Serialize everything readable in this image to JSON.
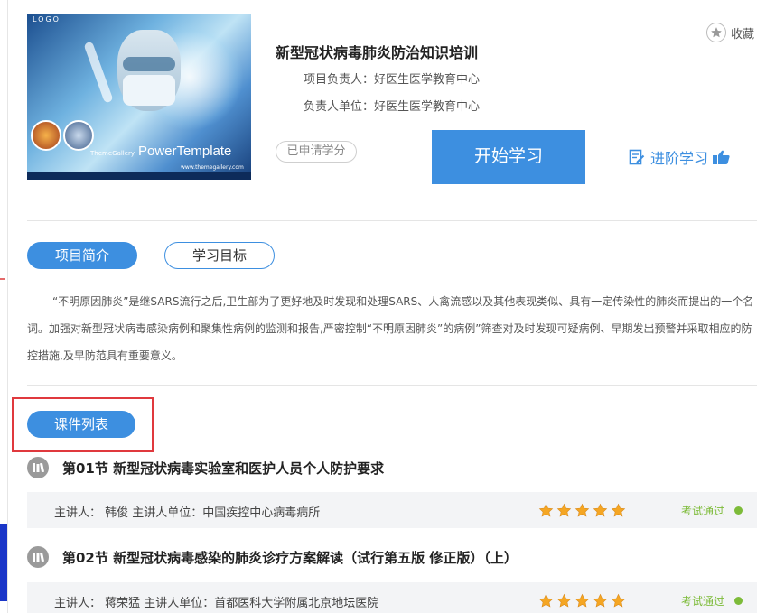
{
  "cover": {
    "logo_text": "LOGO",
    "brand_small": "ThemeGallery",
    "brand": "PowerTemplate",
    "url": "www.themegallery.com"
  },
  "course": {
    "title": "新型冠状病毒肺炎防治知识培训",
    "leader": "项目负责人：好医生医学教育中心",
    "unit": "负责人单位：好医生医学教育中心",
    "credit_badge": "已申请学分",
    "start_label": "开始学习",
    "advance_label": "进阶学习",
    "favorite_label": "收藏"
  },
  "tabs": [
    {
      "label": "项目简介",
      "active": true
    },
    {
      "label": "学习目标",
      "active": false
    }
  ],
  "intro_text": "“不明原因肺炎”是继SARS流行之后,卫生部为了更好地及时发现和处理SARS、人禽流感以及其他表现类似、具有一定传染性的肺炎而提出的一个名词。加强对新型冠状病毒感染病例和聚集性病例的监测和报告,严密控制“不明原因肺炎”的病例”筛查对及时发现可疑病例、早期发出预警并采取相应的防控措施,及早防范具有重要意义。",
  "section_label": "课件列表",
  "lessons": [
    {
      "title": "第01节 新型冠状病毒实验室和医护人员个人防护要求",
      "meta": "主讲人： 韩俊     主讲人单位：中国疾控中心病毒病所",
      "stars": 5,
      "status": "考试通过"
    },
    {
      "title": "第02节 新型冠状病毒感染的肺炎诊疗方案解读（试行第五版 修正版）（上）",
      "meta": "主讲人： 蒋荣猛     主讲人单位：首都医科大学附属北京地坛医院",
      "stars": 5,
      "status": "考试通过"
    }
  ],
  "colors": {
    "accent": "#3d8fe0",
    "highlight_box": "#e0393e",
    "pass": "#7dbb39",
    "star": "#f5a623"
  }
}
